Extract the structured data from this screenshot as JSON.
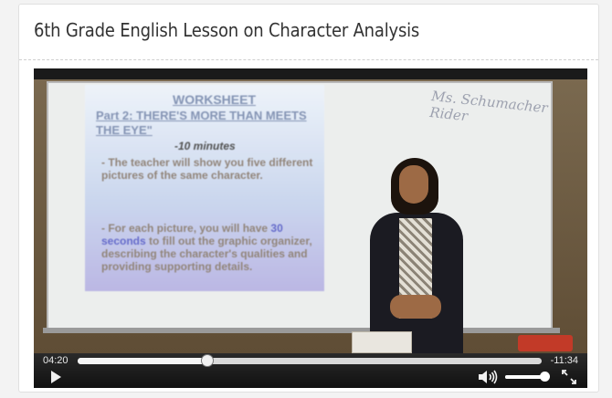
{
  "card": {
    "title": "6th Grade English Lesson on Character Analysis"
  },
  "video": {
    "slide": {
      "heading": "WORKSHEET",
      "part": "Part 2: THERE'S MORE THAN MEETS THE EYE\"",
      "duration": "-10 minutes",
      "bullet1": "- The teacher will show you five different pictures of the same character.",
      "bullet2_a": "- For each picture, you will have ",
      "bullet2_b": "30 seconds",
      "bullet2_c": " to fill out the graphic organizer, describing the character's qualities and providing supporting details."
    },
    "whiteboard_text": "Ms. Schumacher Rider"
  },
  "controls": {
    "current_time": "04:20",
    "remaining_time": "-11:34",
    "progress_fraction": 0.28,
    "volume_fraction": 0.9,
    "icons": {
      "play": "play-icon",
      "volume": "volume-icon",
      "fullscreen": "fullscreen-icon"
    }
  }
}
